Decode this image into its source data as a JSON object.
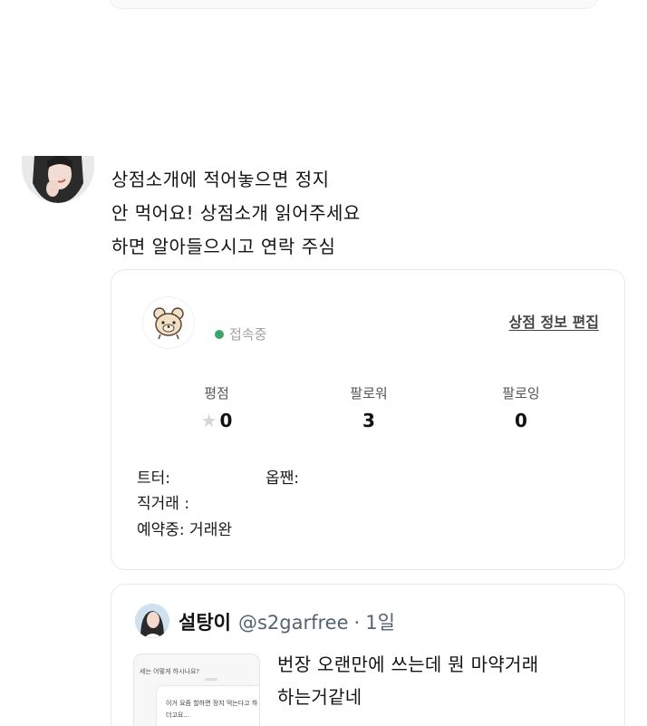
{
  "post": {
    "lines": [
      "상점소개에 적어놓으면 정지",
      "안 먹어요! 상점소개 읽어주세요",
      "하면 알아들으시고 연락 주심"
    ]
  },
  "shop_card": {
    "status": "접속중",
    "edit_link": "상점 정보 편집",
    "stats": [
      {
        "label": "평점",
        "value": "0"
      },
      {
        "label": "팔로워",
        "value": "3"
      },
      {
        "label": "팔로잉",
        "value": "0"
      }
    ],
    "info": {
      "twitter": "트터:",
      "openchat": "옵짼:",
      "direct_trade": "직거래 :",
      "reserved": "예약중: 거래완"
    },
    "status_color": "#3aa66a"
  },
  "quote": {
    "name": "설탕이",
    "handle": "@s2garfree",
    "dot": "·",
    "time": "1일",
    "thumb_lines": [
      "세는 어떻게 하시나요?",
      "이거 요즘 할하면 정지 먹는다고 하",
      "더고요..."
    ],
    "lines": [
      "번장  오랜만에 쓰는데 뭔 마약거래",
      "하는거같네"
    ]
  },
  "icons": {
    "rating": "star-icon",
    "status": "online-dot-icon",
    "logo": "bear-logo-icon"
  }
}
